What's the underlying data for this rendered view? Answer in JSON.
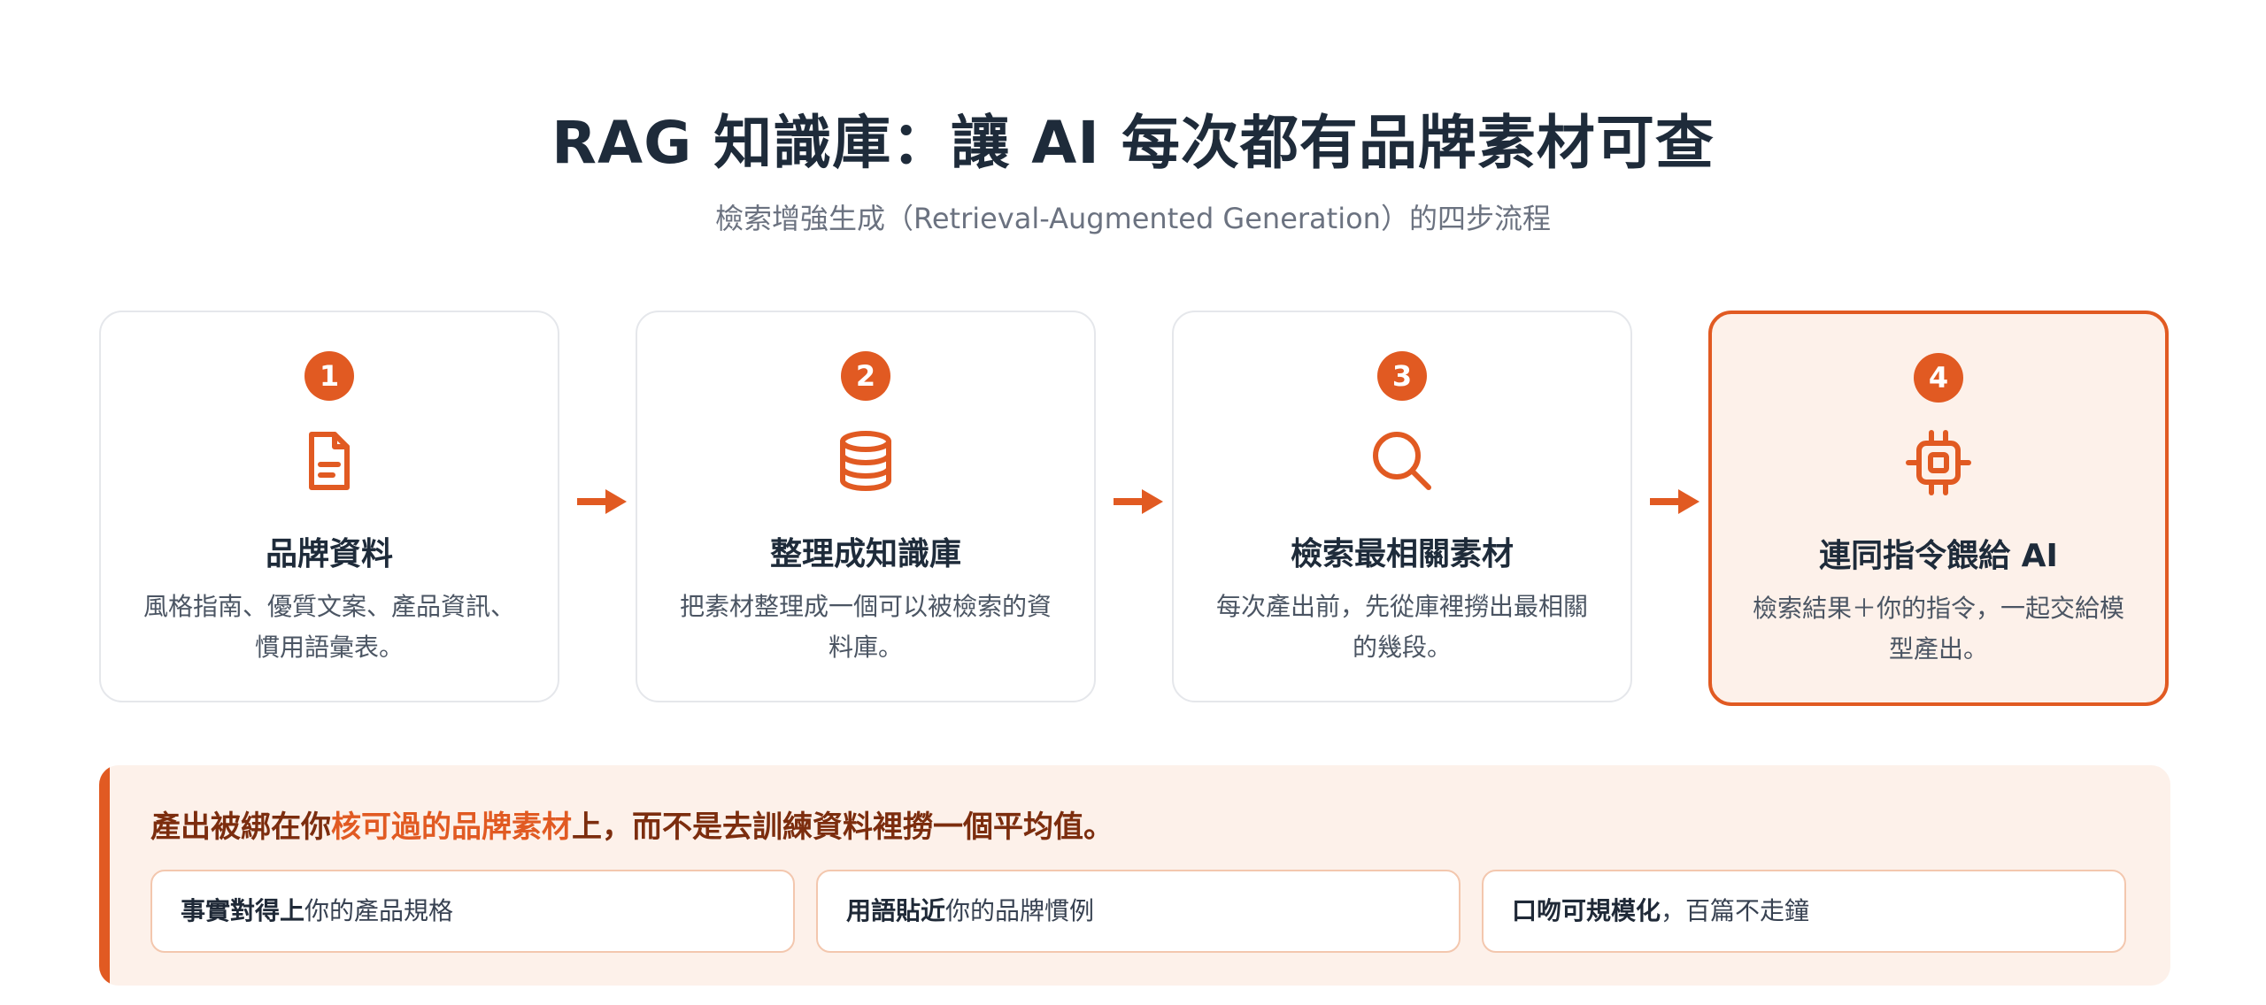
{
  "title": "RAG 知識庫：讓 AI 每次都有品牌素材可查",
  "subtitle": "檢索增強生成（Retrieval-Augmented Generation）的四步流程",
  "colors": {
    "accent": "#e15a22",
    "accent_soft": "#fdf1ea",
    "title": "#1e2b3a",
    "callout_text": "#7c2d0e"
  },
  "steps": [
    {
      "number": "1",
      "icon": "document-icon",
      "title": "品牌資料",
      "desc_line1": "風格指南、優質文案、產品資訊、",
      "desc_line2": "慣用語彙表。"
    },
    {
      "number": "2",
      "icon": "database-icon",
      "title": "整理成知識庫",
      "desc_line1": "把素材整理成一個可以被檢索的資",
      "desc_line2": "料庫。"
    },
    {
      "number": "3",
      "icon": "search-icon",
      "title": "檢索最相關素材",
      "desc_line1": "每次產出前，先從庫裡撈出最相關",
      "desc_line2": "的幾段。"
    },
    {
      "number": "4",
      "icon": "chip-icon",
      "title": "連同指令餵給 AI",
      "desc_line1": "檢索結果＋你的指令，一起交給模",
      "desc_line2": "型產出。"
    }
  ],
  "callout": {
    "text_before": "產出被綁在你",
    "text_highlight": "核可過的品牌素材",
    "text_after": "上，而不是去訓練資料裡撈一個平均值。",
    "chips": [
      {
        "bold": "事實對得上",
        "rest": "你的產品規格"
      },
      {
        "bold": "用語貼近",
        "rest": "你的品牌慣例"
      },
      {
        "bold": "口吻可規模化",
        "rest": "，百篇不走鐘"
      }
    ]
  }
}
